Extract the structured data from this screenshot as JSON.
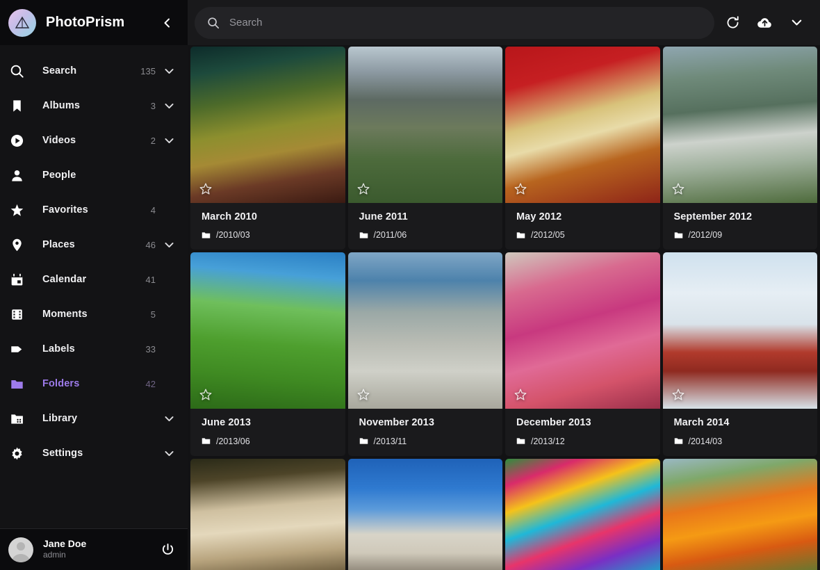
{
  "app": {
    "title": "PhotoPrism",
    "logo_icon": "prism-triangle-logo",
    "collapse_icon": "chevron-left-icon",
    "accent_color": "#9d7bea",
    "sidebar_bg": "#131315",
    "main_bg": "#121214",
    "card_bg": "#1a1a1c"
  },
  "sidebar": {
    "items": [
      {
        "label": "Search",
        "count": "135",
        "icon": "search-icon",
        "expandable": true,
        "active": false
      },
      {
        "label": "Albums",
        "count": "3",
        "icon": "bookmark-icon",
        "expandable": true,
        "active": false
      },
      {
        "label": "Videos",
        "count": "2",
        "icon": "play-circle-icon",
        "expandable": true,
        "active": false
      },
      {
        "label": "People",
        "count": "",
        "icon": "person-icon",
        "expandable": false,
        "active": false
      },
      {
        "label": "Favorites",
        "count": "4",
        "icon": "star-icon",
        "expandable": false,
        "active": false
      },
      {
        "label": "Places",
        "count": "46",
        "icon": "map-pin-icon",
        "expandable": true,
        "active": false
      },
      {
        "label": "Calendar",
        "count": "41",
        "icon": "calendar-icon",
        "expandable": false,
        "active": false
      },
      {
        "label": "Moments",
        "count": "5",
        "icon": "film-strip-icon",
        "expandable": false,
        "active": false
      },
      {
        "label": "Labels",
        "count": "33",
        "icon": "tag-icon",
        "expandable": false,
        "active": false
      },
      {
        "label": "Folders",
        "count": "42",
        "icon": "folder-icon",
        "expandable": false,
        "active": true
      },
      {
        "label": "Library",
        "count": "",
        "icon": "library-icon",
        "expandable": true,
        "active": false
      },
      {
        "label": "Settings",
        "count": "",
        "icon": "gear-icon",
        "expandable": true,
        "active": false
      }
    ],
    "user": {
      "name": "Jane Doe",
      "role": "admin",
      "avatar_icon": "avatar-placeholder",
      "logout_icon": "power-icon"
    }
  },
  "toolbar": {
    "search_placeholder": "Search",
    "search_value": "",
    "search_icon": "search-icon",
    "actions": [
      {
        "icon": "refresh-icon",
        "name": "reload-button"
      },
      {
        "icon": "cloud-upload-icon",
        "name": "upload-button"
      },
      {
        "icon": "chevron-down-icon",
        "name": "more-menu-button"
      }
    ]
  },
  "folders": {
    "cards": [
      {
        "title": "March 2010",
        "path": "/2010/03",
        "folder_icon": "folder-icon",
        "star_icon": "star-outline-icon",
        "favorite": false,
        "thumb": "market-candy-stall"
      },
      {
        "title": "June 2011",
        "path": "/2011/06",
        "folder_icon": "folder-icon",
        "star_icon": "star-outline-icon",
        "favorite": false,
        "thumb": "alpine-mountain-hut"
      },
      {
        "title": "May 2012",
        "path": "/2012/05",
        "folder_icon": "folder-icon",
        "star_icon": "star-outline-icon",
        "favorite": false,
        "thumb": "red-flower-macro"
      },
      {
        "title": "September 2012",
        "path": "/2012/09",
        "folder_icon": "folder-icon",
        "star_icon": "star-outline-icon",
        "favorite": false,
        "thumb": "green-cottage-house"
      },
      {
        "title": "June 2013",
        "path": "/2013/06",
        "folder_icon": "folder-icon",
        "star_icon": "star-outline-icon",
        "favorite": false,
        "thumb": "green-grass-sky"
      },
      {
        "title": "November 2013",
        "path": "/2013/11",
        "folder_icon": "folder-icon",
        "star_icon": "star-outline-icon",
        "favorite": false,
        "thumb": "penguin-beach"
      },
      {
        "title": "December 2013",
        "path": "/2013/12",
        "folder_icon": "folder-icon",
        "star_icon": "star-outline-icon",
        "favorite": false,
        "thumb": "pink-coral-reef"
      },
      {
        "title": "March 2014",
        "path": "/2014/03",
        "folder_icon": "folder-icon",
        "star_icon": "star-outline-icon",
        "favorite": false,
        "thumb": "ski-slope-snow-car"
      },
      {
        "title": "",
        "path": "",
        "folder_icon": "folder-icon",
        "star_icon": "star-outline-icon",
        "favorite": false,
        "thumb": "puppy-dog"
      },
      {
        "title": "",
        "path": "",
        "folder_icon": "folder-icon",
        "star_icon": "star-outline-icon",
        "favorite": false,
        "thumb": "lighthouse-blue-sky"
      },
      {
        "title": "",
        "path": "",
        "folder_icon": "folder-icon",
        "star_icon": "star-outline-icon",
        "favorite": false,
        "thumb": "colorful-graffiti-art"
      },
      {
        "title": "",
        "path": "",
        "folder_icon": "folder-icon",
        "star_icon": "star-outline-icon",
        "favorite": false,
        "thumb": "orange-flowers"
      }
    ]
  }
}
